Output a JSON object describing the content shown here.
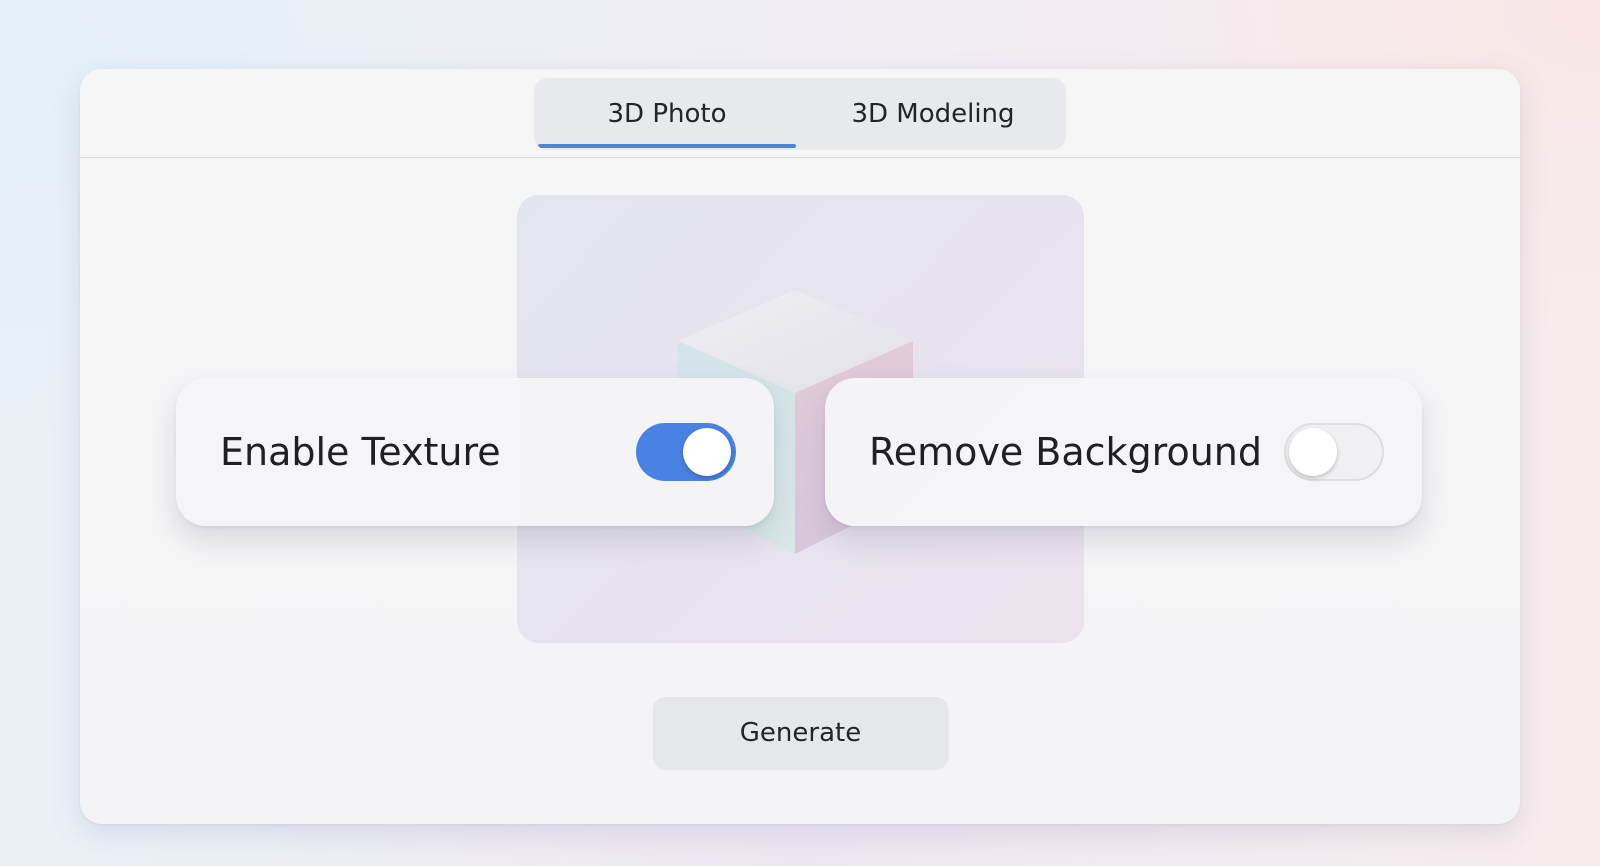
{
  "tabs": [
    {
      "label": "3D Photo",
      "active": true
    },
    {
      "label": "3D Modeling",
      "active": false
    }
  ],
  "preview": {
    "icon": "cube-icon"
  },
  "options": {
    "enable_texture": {
      "label": "Enable Texture",
      "enabled": true
    },
    "remove_background": {
      "label": "Remove Background",
      "enabled": false
    }
  },
  "actions": {
    "generate_label": "Generate"
  },
  "colors": {
    "accent": "#4a82e3",
    "tab_indicator": "#4d84d6"
  }
}
